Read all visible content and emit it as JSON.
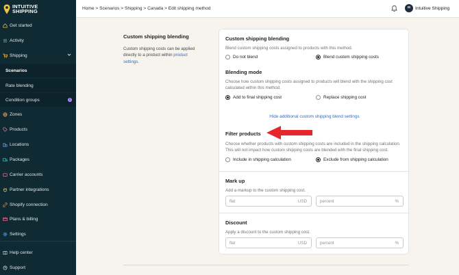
{
  "brand": {
    "line1": "INTUITIVE",
    "line2": "SHIPPING",
    "accent": "#f5c242"
  },
  "sidebar": {
    "items": [
      {
        "label": "Get started",
        "icon": "home-icon"
      },
      {
        "label": "Activity",
        "icon": "list-icon"
      },
      {
        "label": "Shipping",
        "icon": "cart-icon"
      },
      {
        "label": "Scenarios"
      },
      {
        "label": "Rate blending"
      },
      {
        "label": "Condition groups",
        "badge": "i"
      },
      {
        "label": "Zones",
        "icon": "globe-icon"
      },
      {
        "label": "Products",
        "icon": "tag-icon"
      },
      {
        "label": "Locations",
        "icon": "building-icon"
      },
      {
        "label": "Packages",
        "icon": "truck-icon"
      },
      {
        "label": "Carrier accounts",
        "icon": "wallet-icon"
      },
      {
        "label": "Partner integrations",
        "icon": "plug-icon"
      },
      {
        "label": "Shopify connection",
        "icon": "link-icon"
      },
      {
        "label": "Plans & billing",
        "icon": "card-icon"
      },
      {
        "label": "Settings",
        "icon": "gear-icon"
      },
      {
        "label": "Help center",
        "icon": "book-icon"
      },
      {
        "label": "Support",
        "icon": "chat-icon"
      }
    ]
  },
  "topbar": {
    "breadcrumb": "Home > Scenarios > Shipping > Canada > Edit shipping method",
    "avatar_initials": "IS",
    "user_name": "Intuitive Shipping"
  },
  "section": {
    "title": "Custom shipping blending",
    "description": "Custom shipping costs can be applied directly to a product within ",
    "description_link": "product settings",
    "description_end": "."
  },
  "card": {
    "blending": {
      "title": "Custom shipping blending",
      "desc": "Blend custom shipping costs assigned to products with this method.",
      "options": [
        "Do not blend",
        "Blend custom shipping costs"
      ]
    },
    "mode": {
      "title": "Blending mode",
      "desc": "Choose how custom shipping costs assigned to products will blend with the shipping cost calculated within this method.",
      "options": [
        "Add to final shipping cost",
        "Replace shipping cost"
      ]
    },
    "hide_link": "Hide additional custom shipping blend settings",
    "filter": {
      "title": "Filter products",
      "desc": "Choose whether products with custom shipping costs are included in the shipping calculation. This will not impact how custom shipping costs are blended with the final shipping cost.",
      "options": [
        "Include in shipping calculation",
        "Exclude from shipping calculation"
      ]
    },
    "markup": {
      "title": "Mark up",
      "desc": "Add a markup to the custom shipping cost.",
      "flat_placeholder": "flat",
      "flat_suffix": "USD",
      "percent_placeholder": "percent",
      "percent_suffix": "%"
    },
    "discount": {
      "title": "Discount",
      "desc": "Apply a discount to the custom shipping cost.",
      "flat_placeholder": "flat",
      "flat_suffix": "USD",
      "percent_placeholder": "percent",
      "percent_suffix": "%"
    }
  },
  "colors": {
    "sidebar_bg": "#0f2a33",
    "page_bg": "#f6f4ec",
    "link": "#2c6ecb",
    "arrow": "#e8262a"
  }
}
